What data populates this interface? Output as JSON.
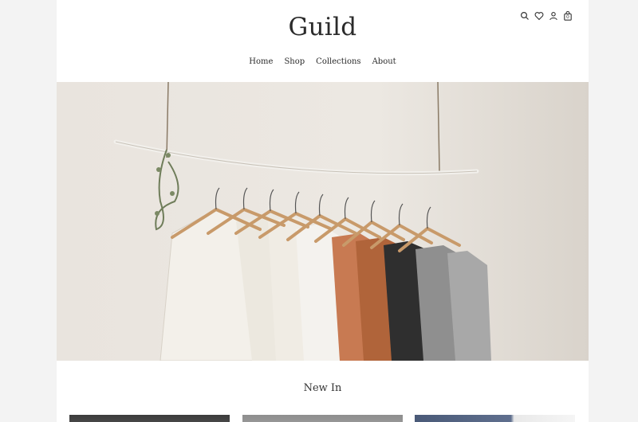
{
  "header": {
    "brand": "Guild",
    "icons": [
      "search-icon",
      "heart-icon",
      "user-icon",
      "cart-icon"
    ],
    "cart_count": "0"
  },
  "nav": {
    "items": [
      "Home",
      "Shop",
      "Collections",
      "About"
    ]
  },
  "hero": {
    "image": "clothes-rack-photo"
  },
  "section": {
    "title": "New In"
  },
  "colors": {
    "page_bg": "#ffffff",
    "outer_bg": "#f3f3f3",
    "text": "#2b2b2b"
  }
}
